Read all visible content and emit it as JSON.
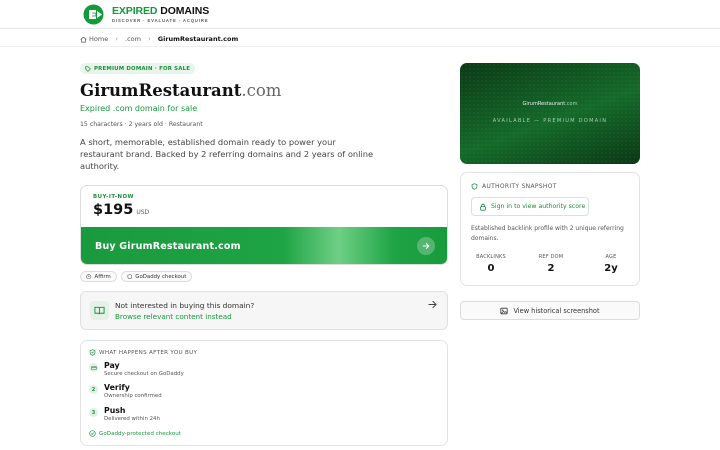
{
  "brand": {
    "name_part1": "EXPIRED",
    "name_part2": " DOMAINS",
    "tagline": "DISCOVER · EVALUATE · ACQUIRE"
  },
  "breadcrumb": {
    "home": "Home",
    "tld": ".com",
    "current": "GirumRestaurant.com"
  },
  "domain": {
    "badge": "PREMIUM DOMAIN · FOR SALE",
    "name": "GirumRestaurant",
    "tld": ".com",
    "subtitle": "Expired .com domain for sale",
    "meta": "15 characters · 2 years old · Restaurant",
    "description": "A short, memorable, established domain ready to power your restaurant brand. Backed by 2 referring domains and 2 years of online authority."
  },
  "buy": {
    "label": "BUY-IT-NOW",
    "price": "$195",
    "currency": "USD",
    "button_label": "Buy GirumRestaurant.com"
  },
  "payment_chips": [
    "Affirm",
    "GoDaddy checkout"
  ],
  "alternative": {
    "title": "Not interested in buying this domain?",
    "link": "Browse relevant content instead"
  },
  "steps": {
    "heading": "WHAT HAPPENS AFTER YOU BUY",
    "items": [
      {
        "num": "1",
        "title": "Pay",
        "sub": "Secure checkout on GoDaddy"
      },
      {
        "num": "2",
        "title": "Verify",
        "sub": "Ownership confirmed"
      },
      {
        "num": "3",
        "title": "Push",
        "sub": "Delivered within 24h"
      }
    ],
    "protected": "GoDaddy-protected checkout"
  },
  "preview": {
    "name": "GirumRestaurant",
    "tld": ".com",
    "caption": "AVAILABLE — PREMIUM DOMAIN"
  },
  "authority": {
    "heading": "AUTHORITY SNAPSHOT",
    "signin_label": "Sign in to view authority score",
    "description": "Established backlink profile with 2 unique referring domains.",
    "stats": [
      {
        "label": "BACKLINKS",
        "value": "0"
      },
      {
        "label": "REF DOM",
        "value": "2"
      },
      {
        "label": "AGE",
        "value": "2y"
      }
    ]
  },
  "history_button": "View historical screenshot",
  "colors": {
    "brand_green": "#139a3b",
    "button_green": "#1ea444",
    "preview_dark_green": "#0f4a1d"
  }
}
